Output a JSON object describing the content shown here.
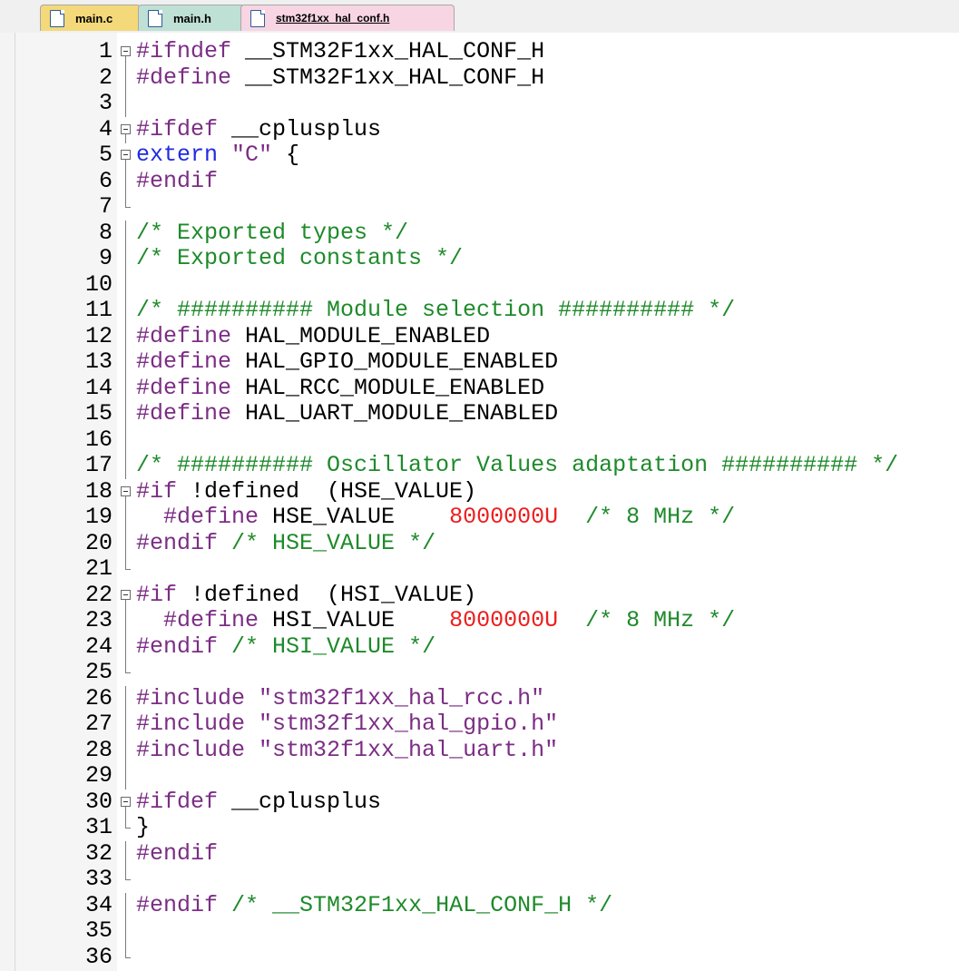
{
  "tabs": [
    {
      "label": "main.c",
      "color": "#f3d97a"
    },
    {
      "label": "main.h",
      "color": "#bfe0d4"
    },
    {
      "label": "stm32f1xx_hal_conf.h",
      "color": "#f8d5e3",
      "active": true
    }
  ],
  "editor": {
    "lines": [
      {
        "n": "1",
        "fold": "box",
        "segs": [
          [
            "pp",
            "#ifndef "
          ],
          [
            "pl",
            "__STM32F1xx_HAL_CONF_H"
          ]
        ]
      },
      {
        "n": "2",
        "fold": "line",
        "segs": [
          [
            "pp",
            "#define "
          ],
          [
            "pl",
            "__STM32F1xx_HAL_CONF_H"
          ]
        ]
      },
      {
        "n": "3",
        "fold": "line",
        "segs": []
      },
      {
        "n": "4",
        "fold": "box",
        "segs": [
          [
            "pp",
            "#ifdef "
          ],
          [
            "pl",
            "__cplusplus"
          ]
        ]
      },
      {
        "n": "5",
        "fold": "box",
        "segs": [
          [
            "kw",
            "extern "
          ],
          [
            "st",
            "\"C\""
          ],
          [
            "pl",
            " {"
          ]
        ]
      },
      {
        "n": "6",
        "fold": "line",
        "segs": [
          [
            "pp",
            "#endif"
          ]
        ]
      },
      {
        "n": "7",
        "fold": "tick",
        "segs": []
      },
      {
        "n": "8",
        "fold": "line",
        "segs": [
          [
            "cm",
            "/* Exported types */"
          ]
        ]
      },
      {
        "n": "9",
        "fold": "line",
        "segs": [
          [
            "cm",
            "/* Exported constants */"
          ]
        ]
      },
      {
        "n": "10",
        "fold": "line",
        "segs": []
      },
      {
        "n": "11",
        "fold": "line",
        "segs": [
          [
            "cm",
            "/* ########## Module selection ########## */"
          ]
        ]
      },
      {
        "n": "12",
        "fold": "line",
        "segs": [
          [
            "pp",
            "#define "
          ],
          [
            "pl",
            "HAL_MODULE_ENABLED"
          ]
        ]
      },
      {
        "n": "13",
        "fold": "line",
        "segs": [
          [
            "pp",
            "#define "
          ],
          [
            "pl",
            "HAL_GPIO_MODULE_ENABLED"
          ]
        ]
      },
      {
        "n": "14",
        "fold": "line",
        "segs": [
          [
            "pp",
            "#define "
          ],
          [
            "pl",
            "HAL_RCC_MODULE_ENABLED"
          ]
        ]
      },
      {
        "n": "15",
        "fold": "line",
        "segs": [
          [
            "pp",
            "#define "
          ],
          [
            "pl",
            "HAL_UART_MODULE_ENABLED"
          ]
        ]
      },
      {
        "n": "16",
        "fold": "line",
        "segs": []
      },
      {
        "n": "17",
        "fold": "line",
        "segs": [
          [
            "cm",
            "/* ########## Oscillator Values adaptation ########## */"
          ]
        ]
      },
      {
        "n": "18",
        "fold": "box",
        "segs": [
          [
            "pp",
            "#if "
          ],
          [
            "pl",
            "!defined  (HSE_VALUE)"
          ]
        ]
      },
      {
        "n": "19",
        "fold": "line",
        "segs": [
          [
            "pp",
            "  #define "
          ],
          [
            "pl",
            "HSE_VALUE    "
          ],
          [
            "nm",
            "8000000U"
          ],
          [
            "cm",
            "  /* 8 MHz */"
          ]
        ]
      },
      {
        "n": "20",
        "fold": "line",
        "segs": [
          [
            "pp",
            "#endif "
          ],
          [
            "cm",
            "/* HSE_VALUE */"
          ]
        ]
      },
      {
        "n": "21",
        "fold": "tick",
        "segs": []
      },
      {
        "n": "22",
        "fold": "box",
        "segs": [
          [
            "pp",
            "#if "
          ],
          [
            "pl",
            "!defined  (HSI_VALUE)"
          ]
        ]
      },
      {
        "n": "23",
        "fold": "line",
        "segs": [
          [
            "pp",
            "  #define "
          ],
          [
            "pl",
            "HSI_VALUE    "
          ],
          [
            "nm",
            "8000000U"
          ],
          [
            "cm",
            "  /* 8 MHz */"
          ]
        ]
      },
      {
        "n": "24",
        "fold": "line",
        "segs": [
          [
            "pp",
            "#endif "
          ],
          [
            "cm",
            "/* HSI_VALUE */"
          ]
        ]
      },
      {
        "n": "25",
        "fold": "tick",
        "segs": []
      },
      {
        "n": "26",
        "fold": "line",
        "segs": [
          [
            "pp",
            "#include "
          ],
          [
            "st",
            "\"stm32f1xx_hal_rcc.h\""
          ]
        ]
      },
      {
        "n": "27",
        "fold": "line",
        "segs": [
          [
            "pp",
            "#include "
          ],
          [
            "st",
            "\"stm32f1xx_hal_gpio.h\""
          ]
        ]
      },
      {
        "n": "28",
        "fold": "line",
        "segs": [
          [
            "pp",
            "#include "
          ],
          [
            "st",
            "\"stm32f1xx_hal_uart.h\""
          ]
        ]
      },
      {
        "n": "29",
        "fold": "line",
        "segs": []
      },
      {
        "n": "30",
        "fold": "box",
        "segs": [
          [
            "pp",
            "#ifdef "
          ],
          [
            "pl",
            "__cplusplus"
          ]
        ]
      },
      {
        "n": "31",
        "fold": "tick",
        "segs": [
          [
            "pl",
            "}"
          ]
        ]
      },
      {
        "n": "32",
        "fold": "line",
        "segs": [
          [
            "pp",
            "#endif"
          ]
        ]
      },
      {
        "n": "33",
        "fold": "tick",
        "segs": []
      },
      {
        "n": "34",
        "fold": "line",
        "segs": [
          [
            "pp",
            "#endif "
          ],
          [
            "cm",
            "/* __STM32F1xx_HAL_CONF_H */"
          ]
        ]
      },
      {
        "n": "35",
        "fold": "line",
        "segs": []
      },
      {
        "n": "36",
        "fold": "tick",
        "segs": []
      }
    ]
  },
  "colors": {
    "preprocessor": "#7b2d84",
    "keyword": "#1f2be0",
    "comment": "#1e8a2a",
    "string": "#7b2d84",
    "number": "#ee1d1d"
  }
}
